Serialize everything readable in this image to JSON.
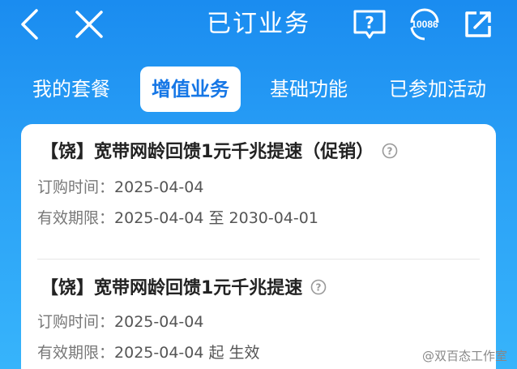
{
  "header": {
    "title": "已订业务",
    "service_number": "10086"
  },
  "tabs": [
    {
      "label": "我的套餐",
      "active": false
    },
    {
      "label": "增值业务",
      "active": true
    },
    {
      "label": "基础功能",
      "active": false
    },
    {
      "label": "已参加活动",
      "active": false
    }
  ],
  "items": [
    {
      "title": "【饶】宽带网龄回馈1元千兆提速（促销）",
      "order_label": "订购时间：",
      "order_date": "2025-04-04",
      "valid_label": "有效期限：",
      "valid_value": "2025-04-04 至 2030-04-01"
    },
    {
      "title": "【饶】宽带网龄回馈1元千兆提速",
      "order_label": "订购时间：",
      "order_date": "2025-04-04",
      "valid_label": "有效期限：",
      "valid_value": "2025-04-04 起 生效"
    }
  ],
  "watermark": "@双百态工作室",
  "colors": {
    "background_top": "#1a8cf0",
    "background_bottom": "#37b4fb",
    "active_tab_text": "#1677e6"
  },
  "icons": [
    "back-icon",
    "close-icon",
    "help-book-icon",
    "customer-service-icon",
    "share-icon",
    "question-icon"
  ]
}
